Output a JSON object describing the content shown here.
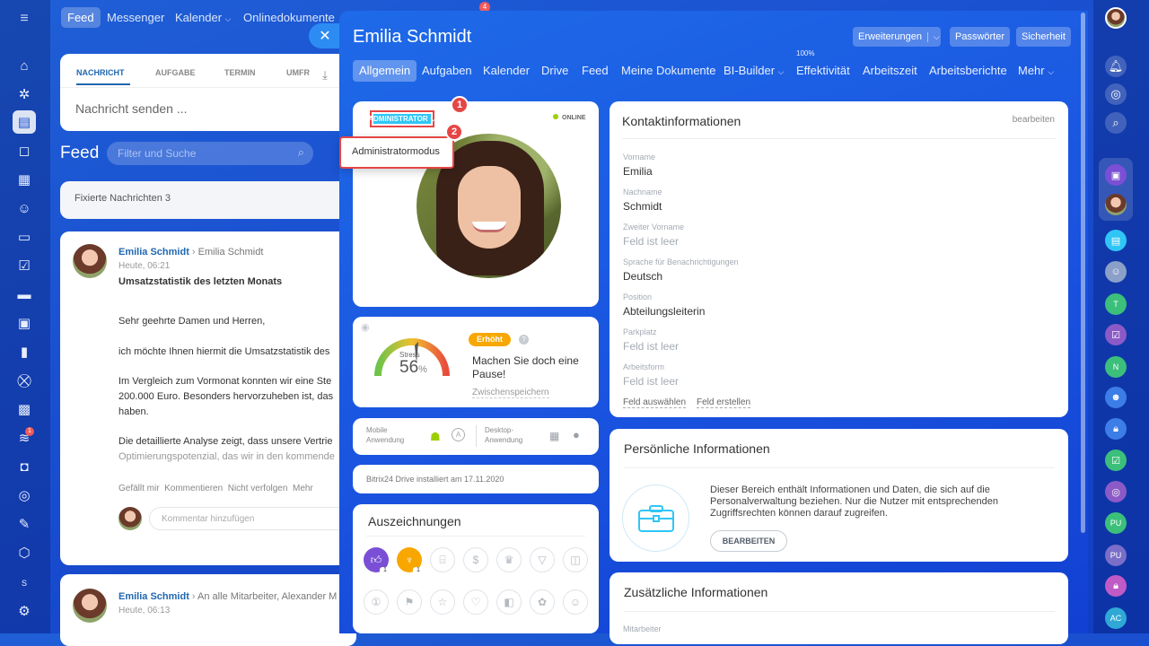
{
  "topnav": {
    "items": [
      "Feed",
      "Messenger",
      "Kalender",
      "Onlinedokumente"
    ],
    "badge": "4"
  },
  "feed": {
    "tabs": [
      "NACHRICHT",
      "AUFGABE",
      "TERMIN",
      "UMFR"
    ],
    "send_placeholder": "Nachricht senden ...",
    "title": "Feed",
    "filter_placeholder": "Filter und Suche",
    "pinned": "Fixierte Nachrichten 3",
    "post1": {
      "author": "Emilia Schmidt",
      "recipient": "Emilia Schmidt",
      "time": "Heute, 06:21",
      "title": "Umsatzstatistik des letzten Monats",
      "p1": "Sehr geehrte Damen und Herren,",
      "p2": "ich möchte Ihnen hiermit die Umsatzstatistik des",
      "p3a": "Im Vergleich zum Vormonat konnten wir eine Ste",
      "p3b": "200.000 Euro. Besonders hervorzuheben ist, das",
      "p3c": "haben.",
      "p4a": "Die detaillierte Analyse zeigt, dass unsere Vertrie",
      "p4b": "Optimierungspotenzial, das wir in den kommende",
      "actions": [
        "Gefällt mir",
        "Kommentieren",
        "Nicht verfolgen",
        "Mehr"
      ],
      "comment_placeholder": "Kommentar hinzufügen"
    },
    "post2": {
      "author": "Emilia Schmidt",
      "recipient": "An alle Mitarbeiter, Alexander M",
      "time": "Heute, 06:13"
    }
  },
  "slider": {
    "title": "Emilia Schmidt",
    "buttons": [
      "Erweiterungen",
      "Passwörter",
      "Sicherheit"
    ],
    "tabs": [
      "Allgemein",
      "Aufgaben",
      "Kalender",
      "Drive",
      "Feed",
      "Meine Dokumente",
      "BI-Builder",
      "Effektivität",
      "Arbeitszeit",
      "Arbeitsberichte",
      "Mehr"
    ],
    "effectivity_pct": "100%",
    "profile": {
      "role_badge": "ADMINISTRATOR",
      "status": "ONLINE",
      "menu_item": "Administratormodus",
      "markers": [
        "1",
        "2"
      ]
    },
    "stress": {
      "label": "Stress",
      "value": "56",
      "unit": "%",
      "level_badge": "Erhöht",
      "message": "Machen Sie doch eine Pause!",
      "save": "Zwischenspeichern"
    },
    "apps": {
      "mobile": "Mobile Anwendung",
      "desktop": "Desktop-Anwendung"
    },
    "drive": "Bitrix24 Drive installiert am 17.11.2020",
    "awards": {
      "title": "Auszeichnungen",
      "counts": [
        "1",
        "1"
      ]
    },
    "contact": {
      "title": "Kontaktinformationen",
      "edit": "bearbeiten",
      "fields": [
        {
          "label": "Vorname",
          "value": "Emilia"
        },
        {
          "label": "Nachname",
          "value": "Schmidt"
        },
        {
          "label": "Zweiter Vorname",
          "value": "Feld ist leer"
        },
        {
          "label": "Sprache für Benachrichtigungen",
          "value": "Deutsch"
        },
        {
          "label": "Position",
          "value": "Abteilungsleiterin"
        },
        {
          "label": "Parkplatz",
          "value": "Feld ist leer"
        },
        {
          "label": "Arbeitsform",
          "value": "Feld ist leer"
        }
      ],
      "select_field": "Feld auswählen",
      "create_field": "Feld erstellen"
    },
    "personal": {
      "title": "Persönliche Informationen",
      "text": "Dieser Bereich enthält Informationen und Daten, die sich auf die Personalverwaltung beziehen. Nur die Nutzer mit entsprechenden Zugriffsrechten können darauf zugreifen.",
      "button": "BEARBEITEN"
    },
    "additional": {
      "title": "Zusätzliche Informationen",
      "field_label": "Mitarbeiter"
    }
  },
  "rightbar": {
    "initials": [
      "T",
      "N",
      "PU",
      "PU",
      "AC"
    ]
  }
}
